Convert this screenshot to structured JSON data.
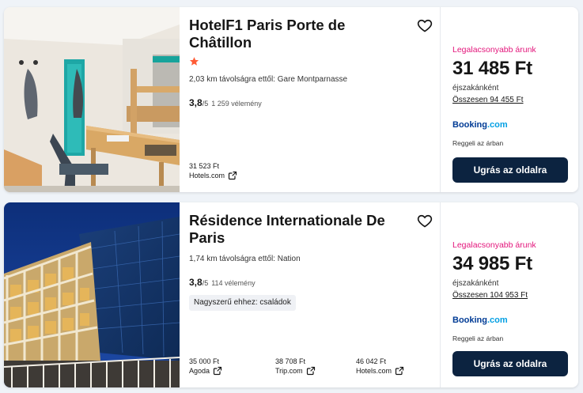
{
  "hotels": [
    {
      "name": "HotelF1 Paris Porte de Châtillon",
      "distance": "2,03 km távolságra ettől: Gare Montparnasse",
      "rating": "3,8",
      "rating_scale": "/5",
      "reviews": "1 259 vélemény",
      "stars": 1,
      "offers": [
        {
          "price": "31 523 Ft",
          "site": "Hotels.com"
        }
      ],
      "lowest_label": "Legalacsonyabb árunk",
      "price": "31 485 Ft",
      "per_night": "éjszakánként",
      "total": "Összesen 94 455 Ft",
      "provider_main": "Booking",
      "provider_suffix": ".com",
      "breakfast": "Reggeli az árban",
      "cta": "Ugrás az oldalra"
    },
    {
      "name": "Résidence Internationale De Paris",
      "distance": "1,74 km távolságra ettől: Nation",
      "rating": "3,8",
      "rating_scale": "/5",
      "reviews": "114 vélemény",
      "tag": "Nagyszerű ehhez: családok",
      "offers": [
        {
          "price": "35 000 Ft",
          "site": "Agoda"
        },
        {
          "price": "38 708 Ft",
          "site": "Trip.com"
        },
        {
          "price": "46 042 Ft",
          "site": "Hotels.com"
        }
      ],
      "lowest_label": "Legalacsonyabb árunk",
      "price": "34 985 Ft",
      "per_night": "éjszakánként",
      "total": "Összesen 104 953 Ft",
      "provider_main": "Booking",
      "provider_suffix": ".com",
      "breakfast": "Reggeli az árban",
      "cta": "Ugrás az oldalra"
    }
  ],
  "colors": {
    "accent_pink": "#e3157b",
    "button_navy": "#0c2340",
    "booking_blue": "#003b95",
    "booking_light": "#009fe3",
    "star_orange": "#ff5b35"
  },
  "icons": [
    "heart-icon",
    "star-icon",
    "external-link-icon"
  ]
}
